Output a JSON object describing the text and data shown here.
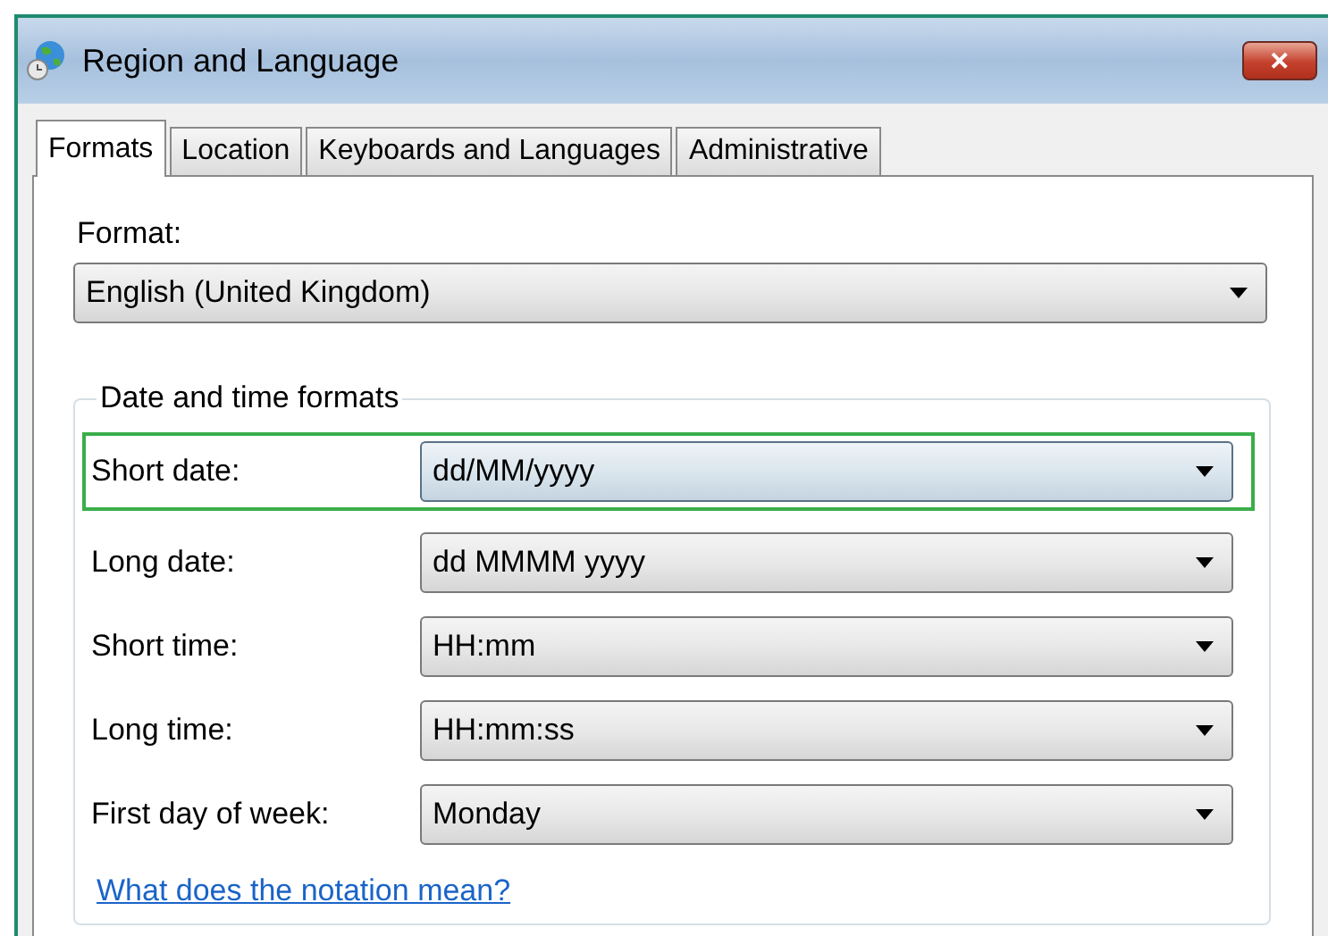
{
  "window": {
    "title": "Region and Language",
    "close": "✕"
  },
  "tabs": [
    {
      "label": "Formats",
      "selected": true
    },
    {
      "label": "Location",
      "selected": false
    },
    {
      "label": "Keyboards and Languages",
      "selected": false
    },
    {
      "label": "Administrative",
      "selected": false
    }
  ],
  "format": {
    "label": "Format:",
    "value": "English (United Kingdom)"
  },
  "group": {
    "title": "Date and time formats",
    "rows": [
      {
        "label": "Short date:",
        "value": "dd/MM/yyyy",
        "highlighted": true
      },
      {
        "label": "Long date:",
        "value": "dd MMMM yyyy",
        "highlighted": false
      },
      {
        "label": "Short time:",
        "value": "HH:mm",
        "highlighted": false
      },
      {
        "label": "Long time:",
        "value": "HH:mm:ss",
        "highlighted": false
      },
      {
        "label": "First day of week:",
        "value": "Monday",
        "highlighted": false
      }
    ],
    "link": "What does the notation mean?"
  }
}
